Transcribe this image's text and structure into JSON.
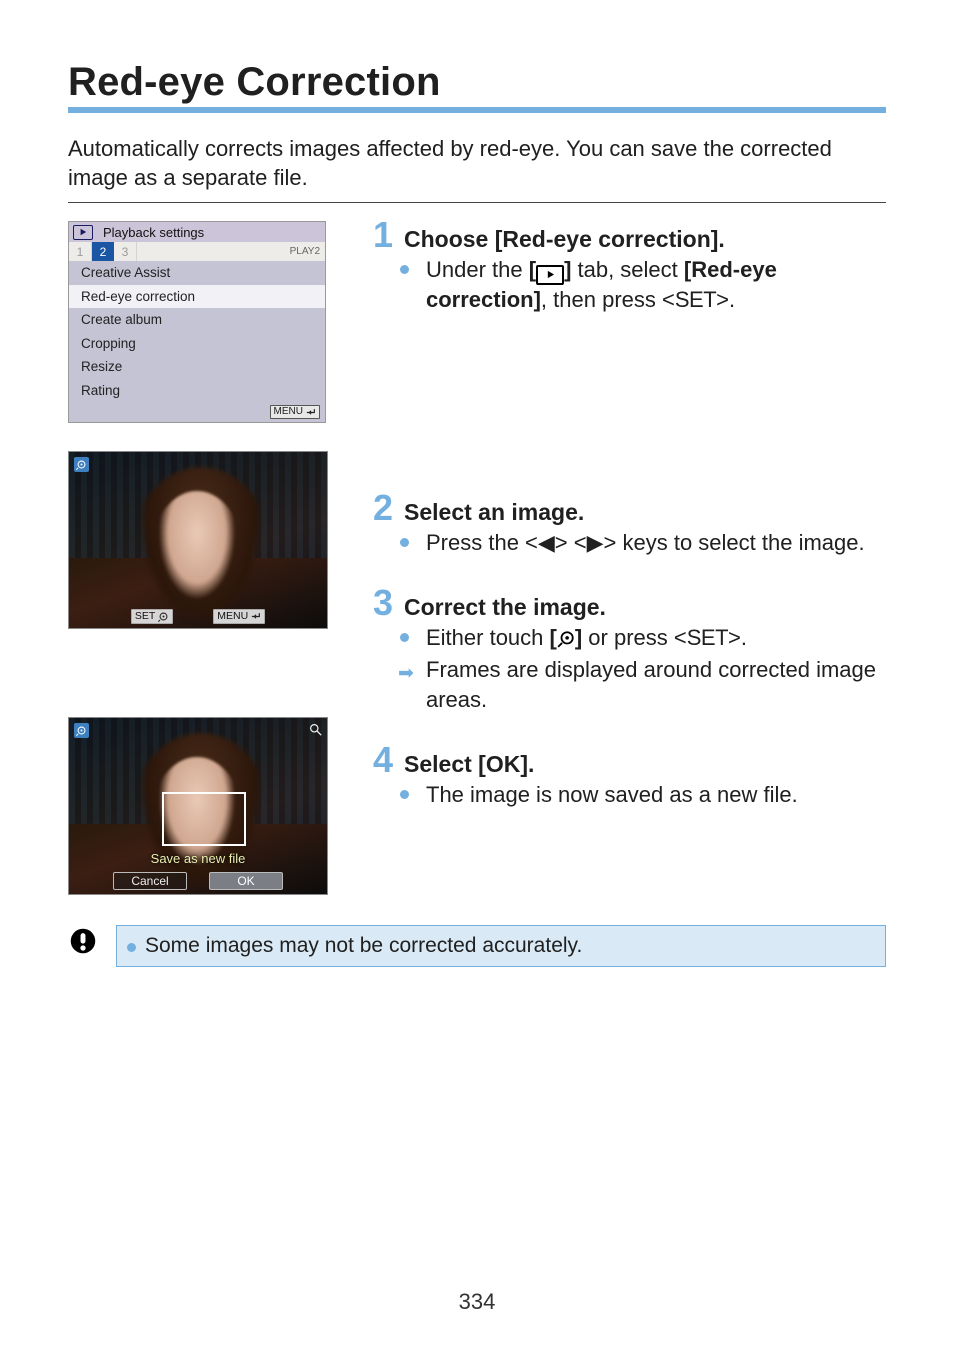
{
  "title": "Red-eye Correction",
  "intro": "Automatically corrects images affected by red-eye. You can save the corrected image as a separate file.",
  "menu": {
    "header_title": "Playback settings",
    "tabs": [
      "1",
      "2",
      "3"
    ],
    "active_tab_index": 1,
    "tab_right_label": "PLAY2",
    "items": [
      "Creative Assist",
      "Red-eye correction",
      "Create album",
      "Cropping",
      "Resize",
      "Rating"
    ],
    "selected_index": 1,
    "footer_label": "MENU"
  },
  "photo2": {
    "chip_left": "SET",
    "chip_right": "MENU"
  },
  "photo3": {
    "banner": "Save as new file",
    "btn_cancel": "Cancel",
    "btn_ok": "OK"
  },
  "steps": {
    "s1": {
      "num": "1",
      "title": "Choose [Red-eye correction].",
      "line_a_1": "Under the ",
      "line_a_2": " tab, select ",
      "line_a_bold": "[Red-eye correction]",
      "line_a_3": ", then press <",
      "set": "SET",
      "line_a_4": ">."
    },
    "s2": {
      "num": "2",
      "title": "Select an image.",
      "line": "Press the <◀> <▶> keys to select the image."
    },
    "s3": {
      "num": "3",
      "title": "Correct the image.",
      "line_a_1": "Either touch ",
      "line_a_bold_open": "[",
      "line_a_bold_close": "]",
      "line_a_2": " or press <",
      "set": "SET",
      "line_a_3": ">.",
      "line_b": "Frames are displayed around corrected image areas."
    },
    "s4": {
      "num": "4",
      "title": "Select [OK].",
      "line": "The image is now saved as a new file."
    }
  },
  "note": "Some images may not be corrected accurately.",
  "page_number": "334"
}
